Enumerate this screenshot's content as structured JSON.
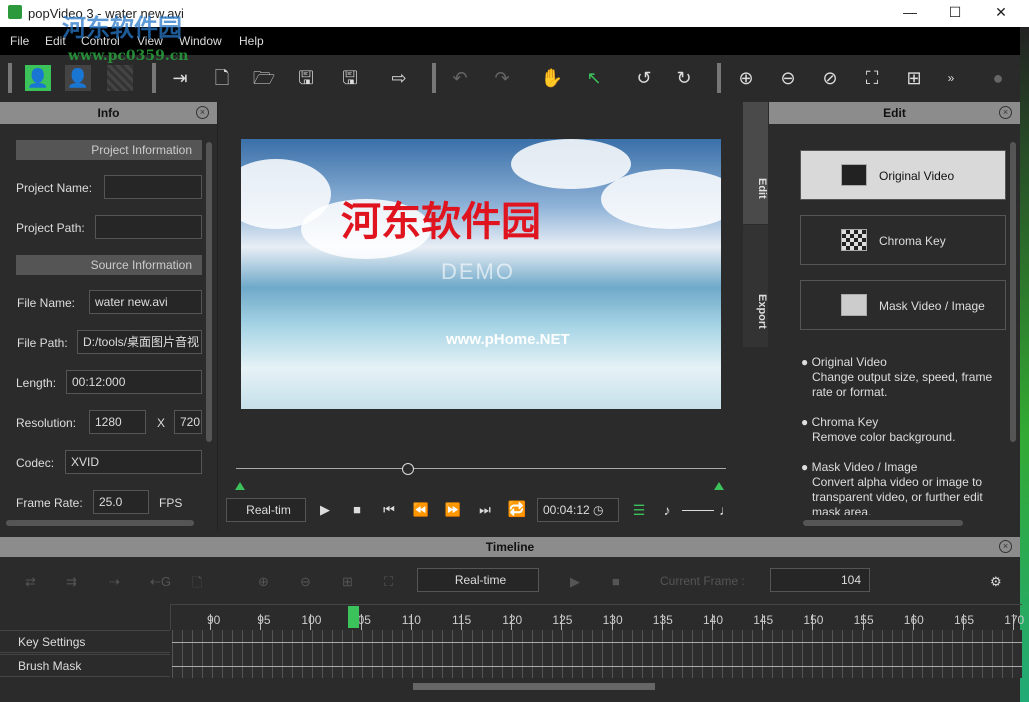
{
  "window": {
    "title": "popVideo 3 - water  new.avi",
    "minimize": "—",
    "maximize": "☐",
    "close": "✕"
  },
  "menu": [
    "File",
    "Edit",
    "Control",
    "View",
    "Window",
    "Help"
  ],
  "watermark": {
    "text": "河东软件园",
    "url": "www.pc0359.cn"
  },
  "info": {
    "title": "Info",
    "project_section": "Project Information",
    "project_name_label": "Project Name:",
    "project_name": "",
    "project_path_label": "Project Path:",
    "project_path": "",
    "source_section": "Source Information",
    "file_name_label": "File Name:",
    "file_name": "water  new.avi",
    "file_path_label": "File Path:",
    "file_path": "D:/tools/桌面图片音视",
    "length_label": "Length:",
    "length": "00:12:000",
    "resolution_label": "Resolution:",
    "width": "1280",
    "x": "X",
    "height": "720",
    "codec_label": "Codec:",
    "codec": "XVID",
    "frame_rate_label": "Frame Rate:",
    "frame_rate": "25.0",
    "fps": "FPS"
  },
  "preview": {
    "overlay_cn": "河东软件园",
    "demo": "DEMO",
    "site": "www.pHome.NET",
    "playback_mode": "Real-tim",
    "time": "00:04:12",
    "progress_percent": 35
  },
  "side_tabs": [
    "Edit",
    "Export"
  ],
  "edit": {
    "title": "Edit",
    "buttons": [
      "Original Video",
      "Chroma Key",
      "Mask Video / Image"
    ],
    "descriptions": [
      {
        "title": "Original Video",
        "text": "Change output size, speed, frame rate or format."
      },
      {
        "title": "Chroma Key",
        "text": "Remove color background."
      },
      {
        "title": "Mask Video / Image",
        "text": "Convert alpha video or image to transparent video, or further edit mask area."
      }
    ]
  },
  "timeline": {
    "title": "Timeline",
    "mode": "Real-time",
    "current_frame_label": "Current Frame :",
    "current_frame": "104",
    "ticks": [
      "90",
      "95",
      "100",
      "05",
      "110",
      "115",
      "120",
      "125",
      "130",
      "135",
      "140",
      "145",
      "150",
      "155",
      "160",
      "165",
      "170"
    ],
    "tracks": [
      "Key Settings",
      "Brush Mask"
    ]
  },
  "colors": {
    "accent": "#3cc25a",
    "panel_header": "#8c8c8c"
  }
}
